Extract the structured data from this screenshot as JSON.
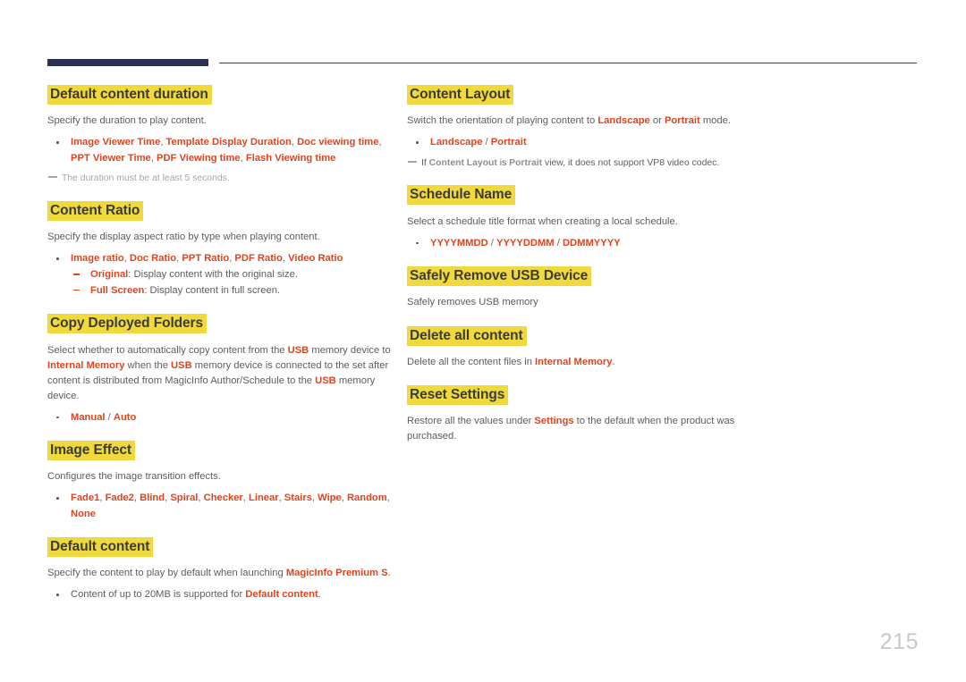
{
  "document": {
    "page_number": "215",
    "header": {
      "tab_color": "#2b3050",
      "rule_color": "#3a3f5c"
    },
    "colors": {
      "accent": "#e0441f",
      "highlight": "#f0d93c",
      "heading_text": "#3c3c3c",
      "body_text": "#5d5d5d",
      "note_text": "#a6a6a6",
      "page_number": "#c9c9c9"
    }
  },
  "left_column": {
    "sections": [
      {
        "heading": "Default content duration",
        "body": "Specify the duration to play content.",
        "bullet": "Image Viewer Time, Template Display Duration, Doc viewing time, PPT Viewer Time, PDF Viewing time, Flash Viewing time",
        "bullet_terms": [
          "Image Viewer Time",
          "Template Display Duration",
          "Doc viewing time",
          "PPT Viewer Time",
          "PDF Viewing time",
          "Flash Viewing time"
        ],
        "note": "The duration must be at least 5 seconds."
      },
      {
        "heading": "Content Ratio",
        "body": "Specify the display aspect ratio by type when playing content.",
        "bullet": "Image ratio, Doc Ratio, PPT Ratio, PDF Ratio, Video Ratio",
        "bullet_terms": [
          "Image ratio",
          "Doc Ratio",
          "PPT Ratio",
          "PDF Ratio",
          "Video Ratio"
        ],
        "subbullets": [
          {
            "term": "Original",
            "text": ": Display content with the original size."
          },
          {
            "term": "Full Screen",
            "text": ": Display content in full screen."
          }
        ]
      },
      {
        "heading": "Copy Deployed Folders",
        "body_parts": [
          {
            "t": "Select whether to automatically copy content from the ",
            "kw": false
          },
          {
            "t": "USB",
            "kw": true
          },
          {
            "t": " memory device to ",
            "kw": false
          },
          {
            "t": "Internal Memory",
            "kw": true
          },
          {
            "t": " when the ",
            "kw": false
          },
          {
            "t": "USB",
            "kw": true
          },
          {
            "t": " memory device is connected to the set after content is distributed from MagicInfo Author/Schedule to the ",
            "kw": false
          },
          {
            "t": "USB",
            "kw": true
          },
          {
            "t": " memory device.",
            "kw": false
          }
        ],
        "options": [
          "Manual",
          "Auto"
        ],
        "options_separator": " / "
      },
      {
        "heading": "Image Effect",
        "body": "Configures the image transition effects.",
        "bullet": "Fade1, Fade2, Blind, Spiral, Checker, Linear, Stairs, Wipe, Random, None",
        "bullet_terms": [
          "Fade1",
          "Fade2",
          "Blind",
          "Spiral",
          "Checker",
          "Linear",
          "Stairs",
          "Wipe",
          "Random",
          "None"
        ]
      },
      {
        "heading": "Default content",
        "body_parts": [
          {
            "t": "Specify the content to play by default when launching ",
            "kw": false
          },
          {
            "t": "MagicInfo Premium S",
            "kw": true
          },
          {
            "t": ".",
            "kw": false
          }
        ],
        "bullet_parts": [
          {
            "t": "Content of up to 20MB is supported for ",
            "kw": false
          },
          {
            "t": "Default content",
            "kw": true
          },
          {
            "t": ".",
            "kw": false
          }
        ]
      }
    ]
  },
  "right_column": {
    "sections": [
      {
        "heading": "Content Layout",
        "body_parts": [
          {
            "t": "Switch the orientation of playing content to ",
            "kw": false
          },
          {
            "t": "Landscape",
            "kw": true
          },
          {
            "t": " or ",
            "kw": false
          },
          {
            "t": "Portrait",
            "kw": true
          },
          {
            "t": " mode.",
            "kw": false
          }
        ],
        "options": [
          "Landscape",
          "Portrait"
        ],
        "options_separator": " / ",
        "note_parts": [
          {
            "t": "If ",
            "kw": false
          },
          {
            "t": "Content Layout",
            "kw": true
          },
          {
            "t": " is ",
            "kw": false
          },
          {
            "t": "Portrait",
            "kw": true
          },
          {
            "t": " view, it does not support VP8 video codec.",
            "kw": false
          }
        ]
      },
      {
        "heading": "Schedule Name",
        "body": "Select a schedule title format when creating a local schedule.",
        "options": [
          "YYYYMMDD",
          "YYYYDDMM",
          "DDMMYYYY"
        ],
        "options_separator": " / "
      },
      {
        "heading": "Safely Remove USB Device",
        "body": "Safely removes USB memory"
      },
      {
        "heading": "Delete all content",
        "body_parts": [
          {
            "t": "Delete all the content files in ",
            "kw": false
          },
          {
            "t": "Internal Memory",
            "kw": true
          },
          {
            "t": ".",
            "kw": false
          }
        ]
      },
      {
        "heading": "Reset Settings",
        "body_parts": [
          {
            "t": "Restore all the values under ",
            "kw": false
          },
          {
            "t": "Settings",
            "kw": true
          },
          {
            "t": " to the default when the product was purchased.",
            "kw": false
          }
        ]
      }
    ]
  }
}
